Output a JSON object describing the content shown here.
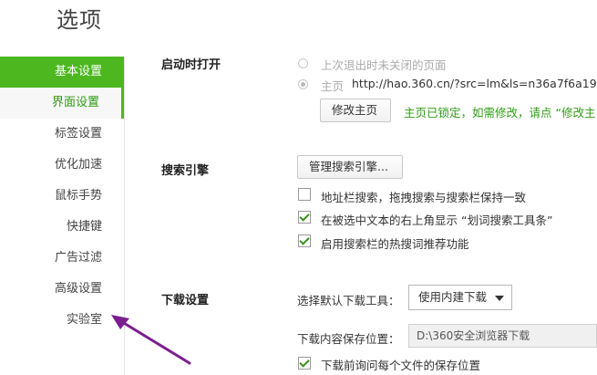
{
  "title": "选项",
  "sidebar": {
    "items": [
      {
        "label": "基本设置"
      },
      {
        "label": "界面设置"
      },
      {
        "label": "标签设置"
      },
      {
        "label": "优化加速"
      },
      {
        "label": "鼠标手势"
      },
      {
        "label": "快捷键"
      },
      {
        "label": "广告过滤"
      },
      {
        "label": "高级设置"
      },
      {
        "label": "实验室"
      }
    ]
  },
  "startup": {
    "title": "启动时打开",
    "option_restore": "上次退出时未关闭的页面",
    "option_home": "主页",
    "home_url": "http://hao.360.cn/?src=lm&ls=n36a7f6a19",
    "modify_home_button": "修改主页",
    "locked_note": "主页已锁定，如需修改，请点 “修改主"
  },
  "search": {
    "title": "搜索引擎",
    "manage_button": "管理搜索引擎...",
    "option1": "地址栏搜索，拖拽搜索与搜索栏保持一致",
    "option2": "在被选中文本的右上角显示 “划词搜索工具条”",
    "option3": "启用搜索栏的热搜词推荐功能"
  },
  "download": {
    "title": "下载设置",
    "tool_label": "选择默认下载工具：",
    "tool_value": "使用内建下载",
    "path_label": "下载内容保存位置：",
    "path_value": "D:\\360安全浏览器下载",
    "ask_label": "下载前询问每个文件的保存位置"
  },
  "colors": {
    "accent": "#4cb71f",
    "link_note": "#2e9a14",
    "annotation_arrow": "#7b1f8f"
  }
}
